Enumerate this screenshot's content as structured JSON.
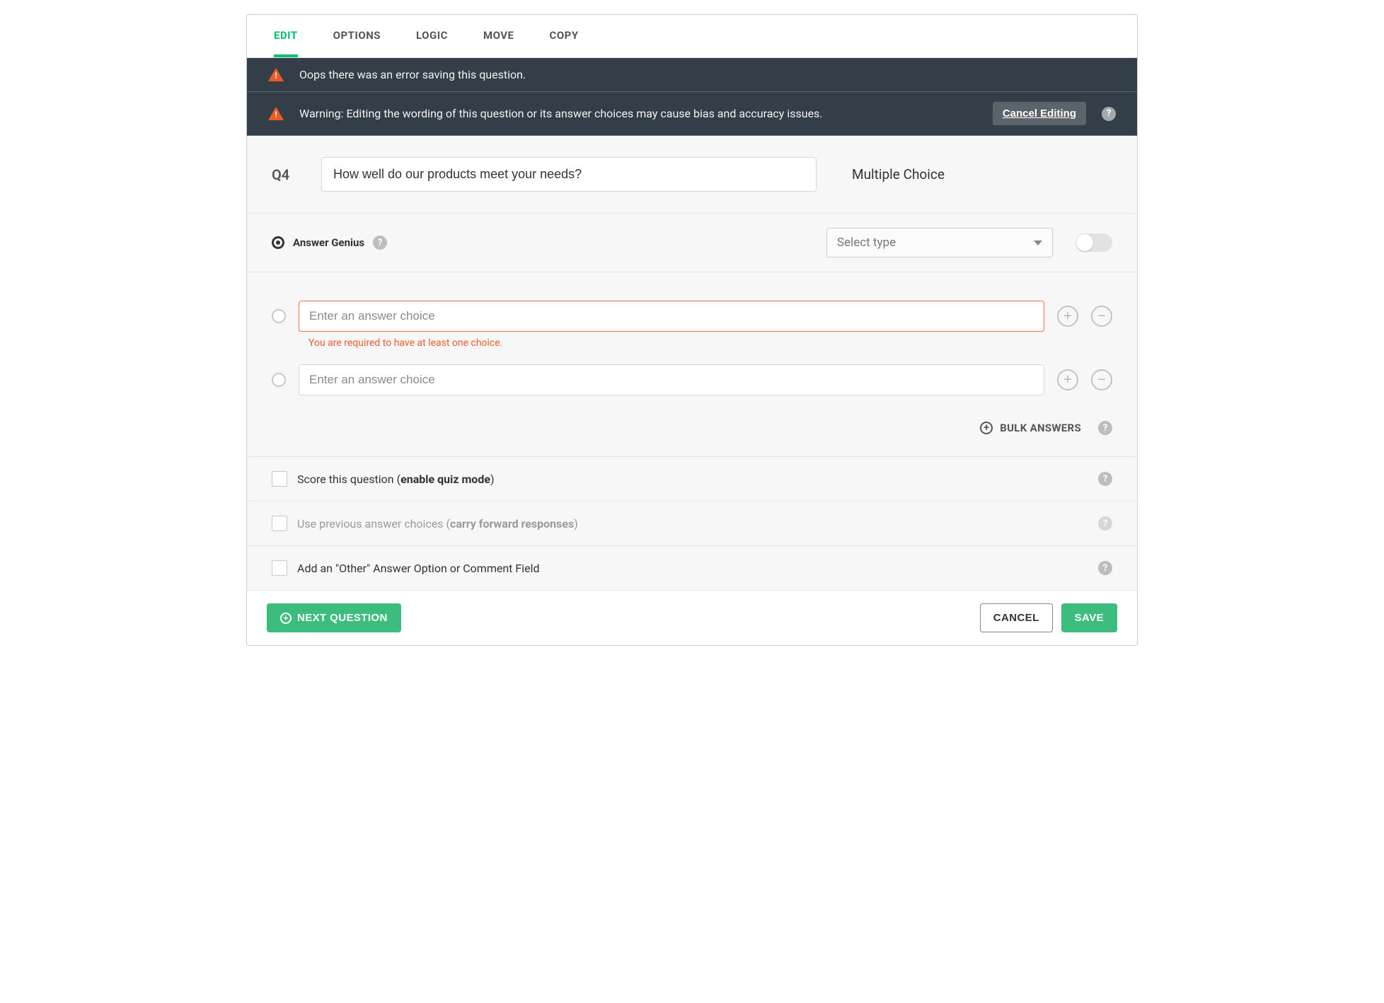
{
  "tabs": {
    "edit": "EDIT",
    "options": "OPTIONS",
    "logic": "LOGIC",
    "move": "MOVE",
    "copy": "COPY"
  },
  "alerts": {
    "error": "Oops there was an error saving this question.",
    "warning": "Warning: Editing the wording of this question or its answer choices may cause bias and accuracy issues.",
    "cancel_editing": "Cancel Editing"
  },
  "question": {
    "number": "Q4",
    "text": "How well do our products meet your needs?",
    "type": "Multiple Choice"
  },
  "genius": {
    "label": "Answer Genius",
    "type_placeholder": "Select type"
  },
  "choices": {
    "placeholder": "Enter an answer choice",
    "validation": "You are required to have at least one choice.",
    "bulk": "BULK ANSWERS"
  },
  "options": {
    "score_prefix": "Score this question (",
    "score_bold": "enable quiz mode",
    "score_suffix": ")",
    "carry_prefix": "Use previous answer choices (",
    "carry_bold": "carry forward responses",
    "carry_suffix": ")",
    "other": "Add an \"Other\" Answer Option or Comment Field"
  },
  "footer": {
    "next": "NEXT QUESTION",
    "cancel": "CANCEL",
    "save": "SAVE"
  }
}
